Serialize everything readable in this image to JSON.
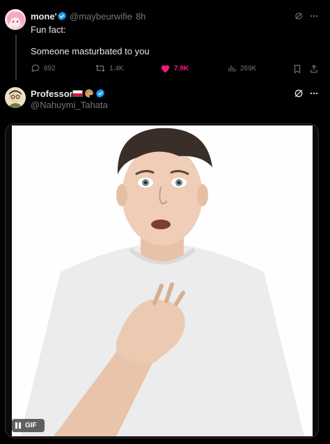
{
  "tweet1": {
    "display_name": "mone'",
    "verified": true,
    "handle": "@maybeurwifie",
    "time": "· 8h",
    "text_line1": "Fun fact:",
    "text_line2": "Someone masturbated to you",
    "actions": {
      "replies": "692",
      "retweets": "1.4K",
      "likes": "7.9K",
      "views": "269K"
    },
    "liked": true
  },
  "tweet2": {
    "display_name": "Professor",
    "flag_emoji": "🇵🇱",
    "verified": true,
    "handle": "@Nahuymi_Tahata",
    "media_type": "GIF"
  },
  "colors": {
    "background": "#000000",
    "text": "#e7e9ea",
    "muted": "#71767b",
    "like": "#f91880",
    "verified": "#1d9bf0"
  },
  "icons": [
    "grok-icon",
    "more-icon",
    "reply-icon",
    "retweet-icon",
    "heart-icon",
    "views-icon",
    "bookmark-icon",
    "share-icon",
    "verified-icon",
    "pause-icon"
  ]
}
